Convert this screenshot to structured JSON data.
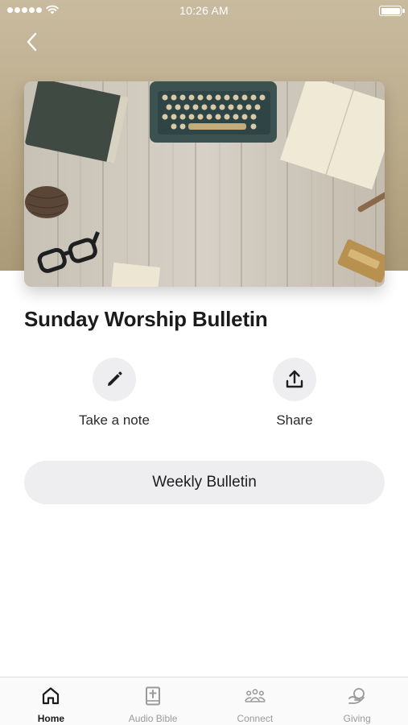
{
  "status_bar": {
    "time": "10:26 AM"
  },
  "page": {
    "title": "Sunday Worship Bulletin",
    "hero_image": "desk-with-typewriter-and-notebook"
  },
  "actions": [
    {
      "label": "Take a note",
      "icon": "pencil-icon"
    },
    {
      "label": "Share",
      "icon": "share-icon"
    }
  ],
  "primary_button": {
    "label": "Weekly Bulletin"
  },
  "tab_bar": {
    "items": [
      {
        "label": "Home",
        "icon": "home-icon",
        "active": true
      },
      {
        "label": "Audio Bible",
        "icon": "bible-icon",
        "active": false
      },
      {
        "label": "Connect",
        "icon": "people-icon",
        "active": false
      },
      {
        "label": "Giving",
        "icon": "giving-icon",
        "active": false
      }
    ]
  },
  "colors": {
    "header_tan": "#b9aa89",
    "button_gray": "#eeeef0",
    "text_dark": "#1b1b1d",
    "tab_inactive": "#9a9a9e"
  }
}
